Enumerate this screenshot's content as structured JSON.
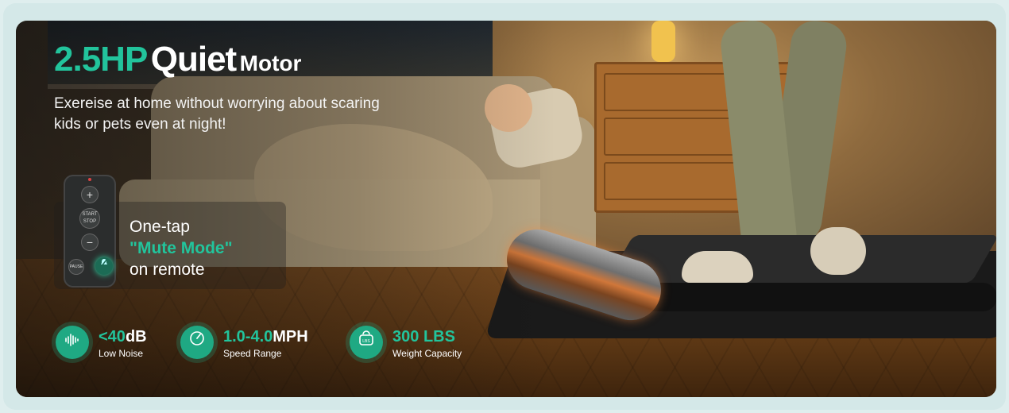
{
  "headline": {
    "hp": "2.5HP",
    "quiet": "Quiet",
    "motor": "Motor"
  },
  "subtitle": "Exereise at home without worrying about scaring kids or pets even at night!",
  "remote": {
    "line1": "One-tap",
    "mute_mode": "\"Mute Mode\"",
    "line3": "on remote",
    "buttons": {
      "plus": "+",
      "start": "START STOP",
      "minus": "−",
      "pause": "PAUSE"
    }
  },
  "stats": [
    {
      "icon": "sound-wave-icon",
      "value_num": "<40",
      "value_unit": "dB",
      "label": "Low Noise"
    },
    {
      "icon": "speedometer-icon",
      "value_num": "1.0-4.0",
      "value_unit": "MPH",
      "label": "Speed Range"
    },
    {
      "icon": "weight-icon",
      "value_num": "300",
      "value_unit": "LBS",
      "label": "Weight Capacity"
    }
  ],
  "colors": {
    "accent": "#22c49c",
    "frame": "#d4e8e8"
  }
}
